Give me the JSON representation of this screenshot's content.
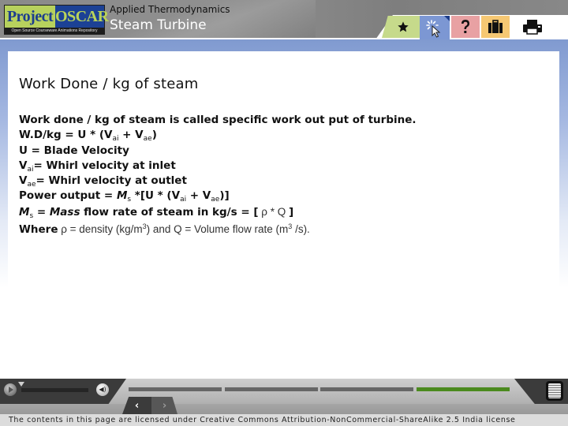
{
  "header": {
    "logo": {
      "word1": "Project",
      "word2": "OSCAR",
      "tagline": "Open Source Courseware Animations Repository"
    },
    "course_title": "Applied Thermodynamics",
    "topic_title": "Steam Turbine"
  },
  "tabs": [
    {
      "name": "star",
      "icon": "star-icon",
      "color": "#c6da8b"
    },
    {
      "name": "interactive",
      "icon": "cursor-click-icon",
      "color": "#7c97d3",
      "active": true
    },
    {
      "name": "help",
      "icon": "question-icon",
      "color": "#e8a1a3"
    },
    {
      "name": "resources",
      "icon": "briefcase-icon",
      "color": "#f6c873"
    },
    {
      "name": "print",
      "icon": "printer-icon",
      "color": "#ffffff"
    }
  ],
  "content": {
    "heading": "Work Done / kg of steam",
    "line1": "Work done / kg of steam is called specific work out put of turbine.",
    "line2": {
      "prefix": "W.D/kg = U * (V",
      "sub1": "ai",
      "mid": " + V",
      "sub2": "ae",
      "suffix": ")"
    },
    "line3": "U = Blade Velocity",
    "line4": {
      "prefix": "V",
      "sub": "ai",
      "suffix": "= Whirl velocity at inlet"
    },
    "line5": {
      "prefix": "V",
      "sub": "ae",
      "suffix": "= Whirl velocity at outlet"
    },
    "line6": {
      "prefix": "Power output  = ",
      "ms": "M",
      "ms_sub": "s",
      "mid": " *[U * (V",
      "sub1": "ai",
      "mid2": " + V",
      "sub2": "ae",
      "suffix": ")]"
    },
    "line7": {
      "ms": "M",
      "ms_sub": "s",
      "text": " = ",
      "italic": "Mass",
      "rest": " flow rate of steam in kg/s = [",
      "formula": " ρ * Q ",
      "close": "]"
    },
    "line8": {
      "bold": "Where",
      "t1": " ρ = density (kg/m",
      "sup1": "3",
      "t2": ") and Q = Volume flow rate (m",
      "sup2": "3",
      "t3": " /s)."
    }
  },
  "player": {
    "play_icon": "play-icon",
    "volume_icon": "speaker-icon",
    "volume_glyph": "◀)",
    "segments_total": 4,
    "current_segment": 4,
    "segment_colors": {
      "inactive": "#666666",
      "current": "#4b8a1e"
    },
    "prev_label": "‹",
    "next_label": "›",
    "notes_icon": "notes-icon"
  },
  "license": "The contents in this page are licensed under Creative Commons Attribution-NonCommercial-ShareAlike 2.5 India license"
}
